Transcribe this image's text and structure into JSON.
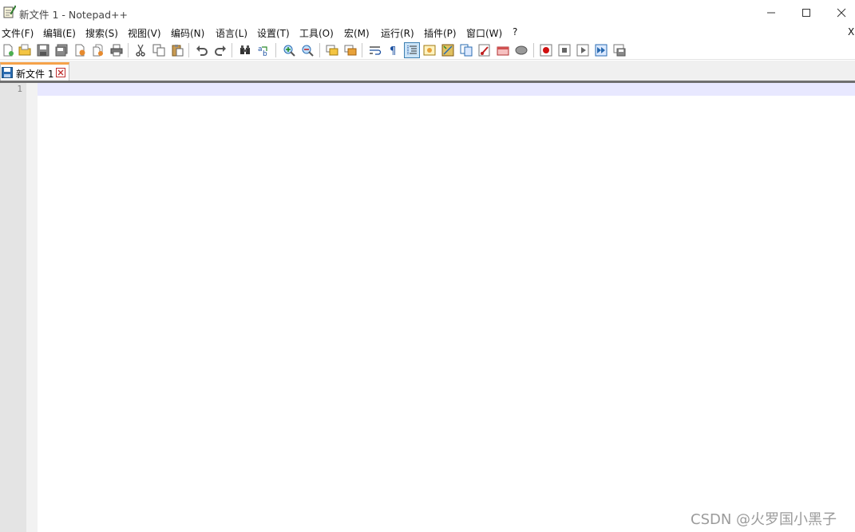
{
  "window": {
    "title": "新文件 1 - Notepad++"
  },
  "menu": {
    "items": [
      {
        "label": "文件(F)"
      },
      {
        "label": "编辑(E)"
      },
      {
        "label": "搜索(S)"
      },
      {
        "label": "视图(V)"
      },
      {
        "label": "编码(N)"
      },
      {
        "label": "语言(L)"
      },
      {
        "label": "设置(T)"
      },
      {
        "label": "工具(O)"
      },
      {
        "label": "宏(M)"
      },
      {
        "label": "运行(R)"
      },
      {
        "label": "插件(P)"
      },
      {
        "label": "窗口(W)"
      },
      {
        "label": "?"
      }
    ],
    "close_label": "X"
  },
  "toolbar": {
    "buttons": [
      {
        "icon": "new-file-icon"
      },
      {
        "icon": "open-file-icon"
      },
      {
        "icon": "save-icon"
      },
      {
        "icon": "save-all-icon"
      },
      {
        "icon": "close-file-icon"
      },
      {
        "icon": "close-all-icon"
      },
      {
        "icon": "print-icon"
      },
      {
        "icon": "cut-icon"
      },
      {
        "icon": "copy-icon"
      },
      {
        "icon": "paste-icon"
      },
      {
        "icon": "undo-icon"
      },
      {
        "icon": "redo-icon"
      },
      {
        "icon": "find-icon"
      },
      {
        "icon": "replace-icon"
      },
      {
        "icon": "zoom-in-icon"
      },
      {
        "icon": "zoom-out-icon"
      },
      {
        "icon": "sync-vertical-icon"
      },
      {
        "icon": "sync-horizontal-icon"
      },
      {
        "icon": "word-wrap-icon"
      },
      {
        "icon": "show-all-characters-icon"
      },
      {
        "icon": "indent-guide-icon",
        "active": true
      },
      {
        "icon": "user-language-icon"
      },
      {
        "icon": "document-map-icon"
      },
      {
        "icon": "function-list-icon"
      },
      {
        "icon": "folder-workspace-icon"
      },
      {
        "icon": "monitoring-icon"
      },
      {
        "icon": "clipboard-history-icon"
      },
      {
        "icon": "record-macro-icon"
      },
      {
        "icon": "stop-macro-icon"
      },
      {
        "icon": "play-macro-icon"
      },
      {
        "icon": "run-macro-multiple-icon"
      },
      {
        "icon": "save-macro-icon"
      }
    ]
  },
  "tabs": [
    {
      "label": "新文件 1",
      "active": true
    }
  ],
  "editor": {
    "line_numbers": [
      "1"
    ]
  },
  "watermark": "CSDN @火罗国小黑子",
  "colors": {
    "tab_accent": "#f5a24a",
    "current_line": "#e8e8ff",
    "gutter": "#e4e4e4",
    "active_button_bg": "#cce4f7"
  }
}
